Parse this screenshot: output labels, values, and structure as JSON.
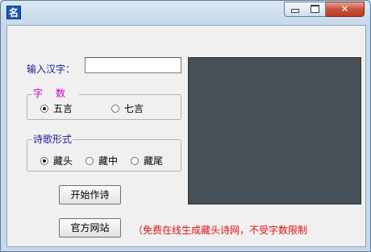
{
  "window": {
    "icon_text": "名",
    "minimize_label": "",
    "maximize_label": "",
    "close_label": "✕"
  },
  "form": {
    "input_label": "输入汉字：",
    "input_value": "",
    "char_count_group": {
      "legend": "字数",
      "options": [
        {
          "label": "五言",
          "checked": true
        },
        {
          "label": "七言",
          "checked": false
        }
      ]
    },
    "poem_form_group": {
      "legend": "诗歌形式",
      "options": [
        {
          "label": "藏头",
          "checked": true
        },
        {
          "label": "藏中",
          "checked": false
        },
        {
          "label": "藏尾",
          "checked": false
        }
      ]
    },
    "start_button": "开始作诗",
    "site_button": "官方网站",
    "notice": "（免费在线生成藏头诗网，不受字数限制"
  },
  "colors": {
    "preview_bg": "#465056",
    "notice": "#e01010",
    "label": "#1a1a9a",
    "legend_char_count": "#cc00cc"
  }
}
